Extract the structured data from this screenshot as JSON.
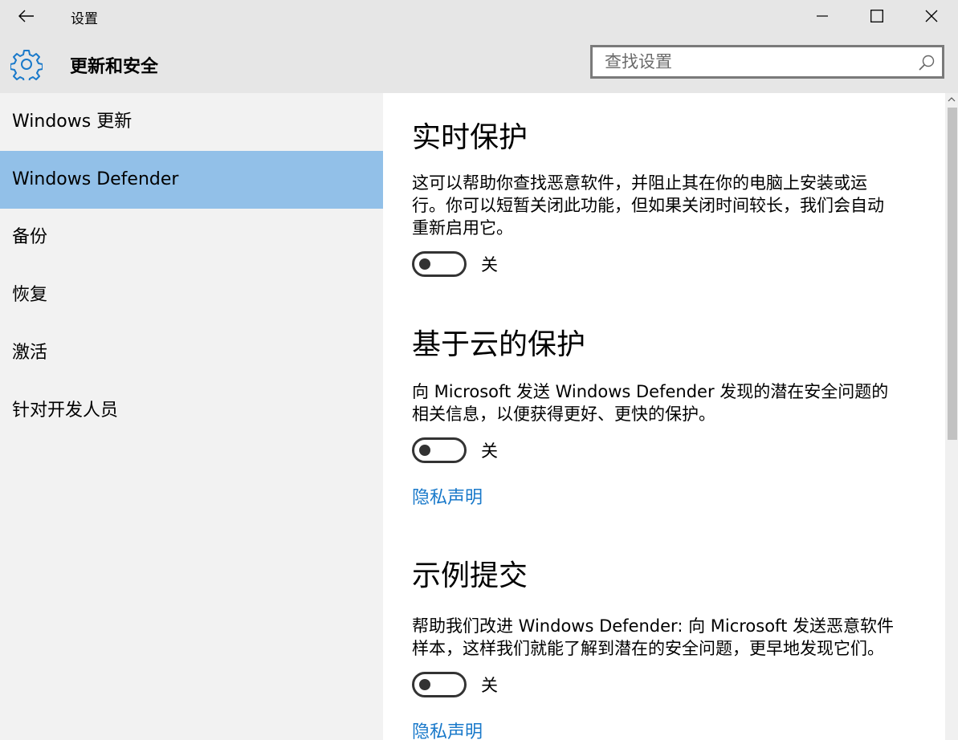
{
  "window": {
    "app_title": "设置",
    "page_title": "更新和安全"
  },
  "search": {
    "placeholder": "查找设置",
    "value": ""
  },
  "sidebar": {
    "items": [
      {
        "label": "Windows 更新",
        "selected": false
      },
      {
        "label": "Windows Defender",
        "selected": true
      },
      {
        "label": "备份",
        "selected": false
      },
      {
        "label": "恢复",
        "selected": false
      },
      {
        "label": "激活",
        "selected": false
      },
      {
        "label": "针对开发人员",
        "selected": false
      }
    ]
  },
  "content": {
    "realtime": {
      "title": "实时保护",
      "desc_lines": [
        "这可以帮助你查找恶意软件，并阻止其在你的电脑上安装或运",
        "行。你可以短暂关闭此功能，但如果关闭时间较长，我们会自动",
        "重新启用它。"
      ],
      "toggle_state": "关",
      "toggle_on": false
    },
    "cloud": {
      "title": "基于云的保护",
      "desc_lines": [
        "向 Microsoft 发送 Windows Defender 发现的潜在安全问题的",
        "相关信息，以便获得更好、更快的保护。"
      ],
      "toggle_state": "关",
      "toggle_on": false,
      "privacy_link": "隐私声明"
    },
    "sample": {
      "title": "示例提交",
      "desc_lines": [
        "帮助我们改进 Windows Defender: 向 Microsoft 发送恶意软件",
        "样本，这样我们就能了解到潜在的安全问题，更早地发现它们。"
      ],
      "toggle_state": "关",
      "toggle_on": false,
      "privacy_link": "隐私声明"
    }
  },
  "colors": {
    "selected_nav": "#92c0e8",
    "link": "#1979ca",
    "accent_icon": "#1979ca"
  },
  "icons": {
    "back": "back-arrow-icon",
    "minimize": "minimize-icon",
    "maximize": "maximize-icon",
    "close": "close-icon",
    "settings": "gear-icon",
    "search": "search-icon"
  }
}
